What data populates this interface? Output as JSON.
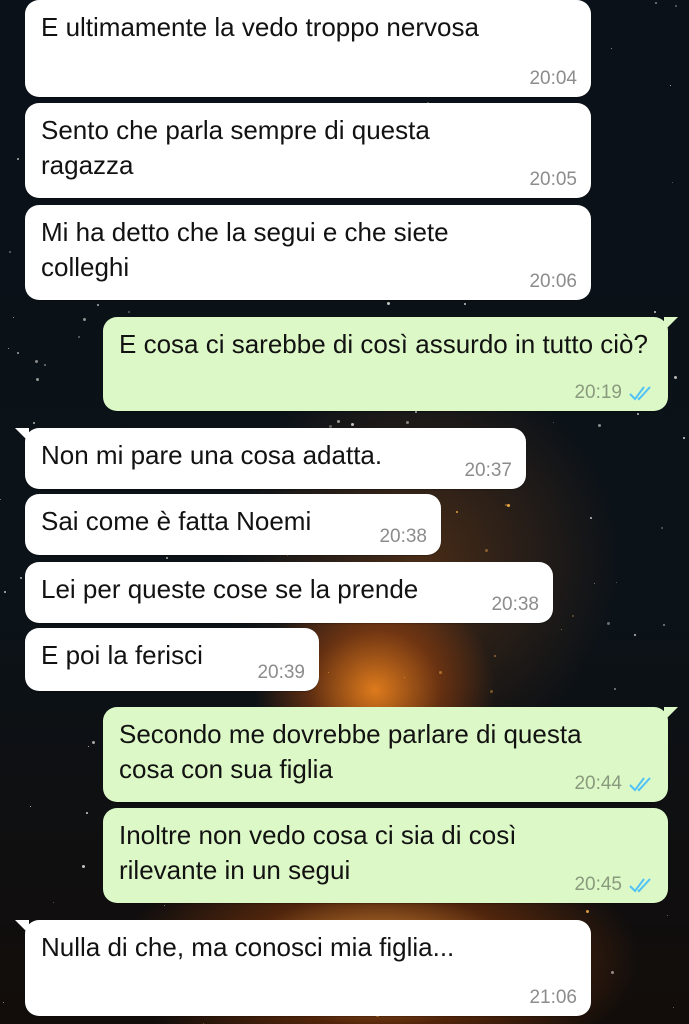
{
  "colors": {
    "incoming_bubble": "#ffffff",
    "outgoing_bubble": "#dcf8c6",
    "read_ticks": "#4fc3f7",
    "timestamp": "#8c8c8c"
  },
  "messages": [
    {
      "direction": "in",
      "text": "E ultimamente la vedo troppo nervosa",
      "time": "20:04"
    },
    {
      "direction": "in",
      "text": "Sento che parla sempre di questa ragazza",
      "time": "20:05"
    },
    {
      "direction": "in",
      "text": "Mi ha detto che la segui e che siete colleghi",
      "time": "20:06"
    },
    {
      "direction": "out",
      "text": "E cosa ci sarebbe di così assurdo in tutto ciò?",
      "time": "20:19",
      "status_icon": "double-check-read-icon"
    },
    {
      "direction": "in",
      "text": "Non mi pare una cosa adatta.",
      "time": "20:37"
    },
    {
      "direction": "in",
      "text": "Sai come è fatta Noemi",
      "time": "20:38"
    },
    {
      "direction": "in",
      "text": "Lei per queste cose se la prende",
      "time": "20:38"
    },
    {
      "direction": "in",
      "text": "E poi la ferisci",
      "time": "20:39"
    },
    {
      "direction": "out",
      "text": "Secondo me dovrebbe parlare di questa cosa con sua figlia",
      "time": "20:44",
      "status_icon": "double-check-read-icon"
    },
    {
      "direction": "out",
      "text": "Inoltre non vedo cosa ci sia di così rilevante in un segui",
      "time": "20:45",
      "status_icon": "double-check-read-icon"
    },
    {
      "direction": "in",
      "text": "Nulla di che, ma conosci mia figlia...",
      "time": "21:06"
    }
  ]
}
